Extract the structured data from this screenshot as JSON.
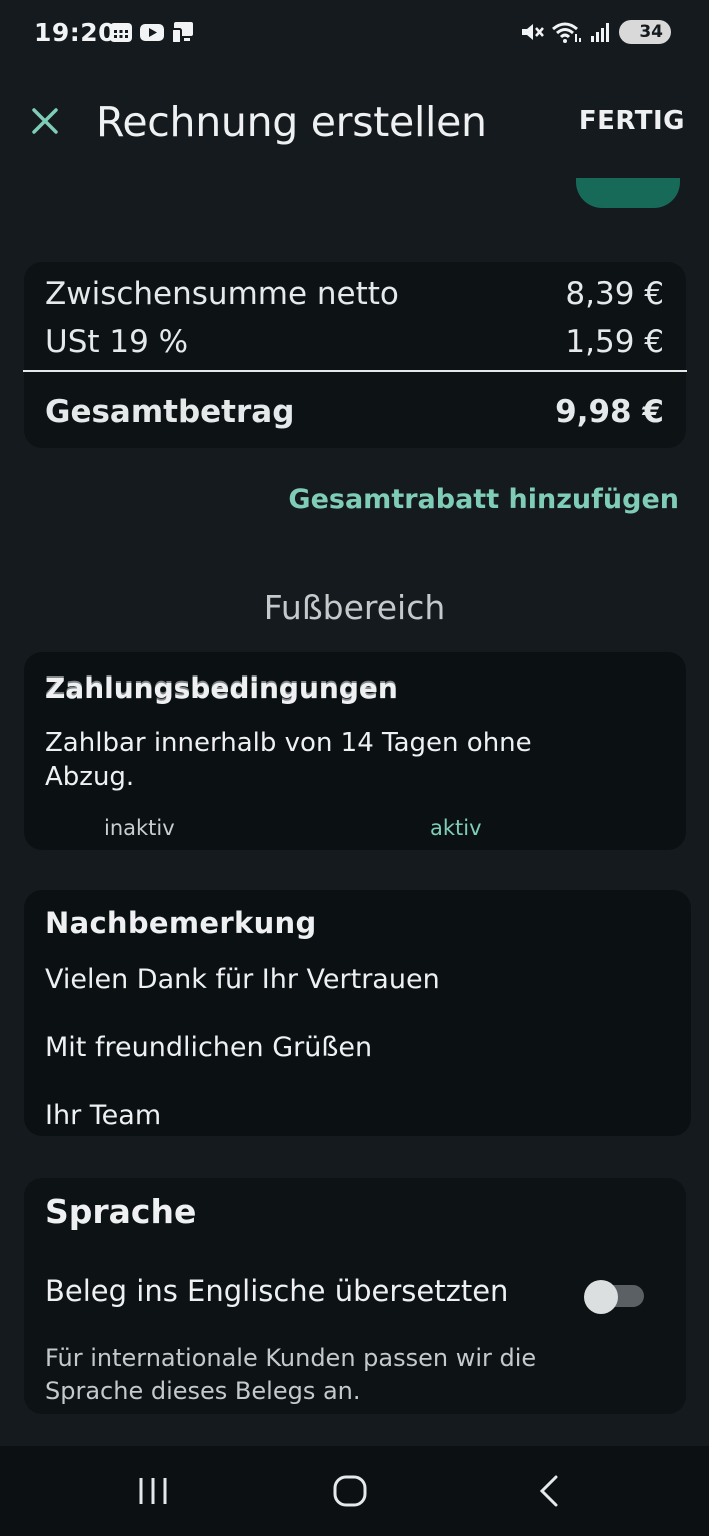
{
  "status_bar": {
    "time": "19:20",
    "battery_level": "34",
    "left_icons": [
      "calendar-icon",
      "youtube-icon",
      "device-icon"
    ],
    "right_icons": [
      "mute-icon",
      "wifi-icon",
      "signal-icon",
      "battery-icon"
    ]
  },
  "app_bar": {
    "title": "Rechnung erstellen",
    "done_label": "FERTIG",
    "close_icon": "close-icon"
  },
  "totals": {
    "subtotal_label": "Zwischensumme netto",
    "subtotal_value": "8,39 €",
    "vat_label": "USt 19 %",
    "vat_value": "1,59 €",
    "total_label": "Gesamtbetrag",
    "total_value": "9,98 €"
  },
  "discount_link": "Gesamtrabatt hinzufügen",
  "footer_section": {
    "heading": "Fußbereich"
  },
  "payment_terms": {
    "title": "Zahlungsbedingungen",
    "text": "Zahlbar innerhalb von 14 Tagen ohne Abzug.",
    "inactive_label": "inaktiv",
    "active_label": "aktiv"
  },
  "note": {
    "title": "Nachbemerkung",
    "lines": [
      "Vielen Dank für Ihr Vertrauen",
      "Mit freundlichen Grüßen",
      "Ihr Team"
    ]
  },
  "language": {
    "title": "Sprache",
    "toggle_label": "Beleg ins Englische übersetzten",
    "toggle_on": false,
    "hint": "Für internationale Kunden passen wir die Sprache dieses Belegs an."
  },
  "colors": {
    "accent": "#7fcdb6",
    "accent_dark": "#176958",
    "background": "#141a1e",
    "card": "#0d1215"
  },
  "nav_bar": {
    "icons": [
      "recents-icon",
      "home-icon",
      "back-icon"
    ]
  }
}
